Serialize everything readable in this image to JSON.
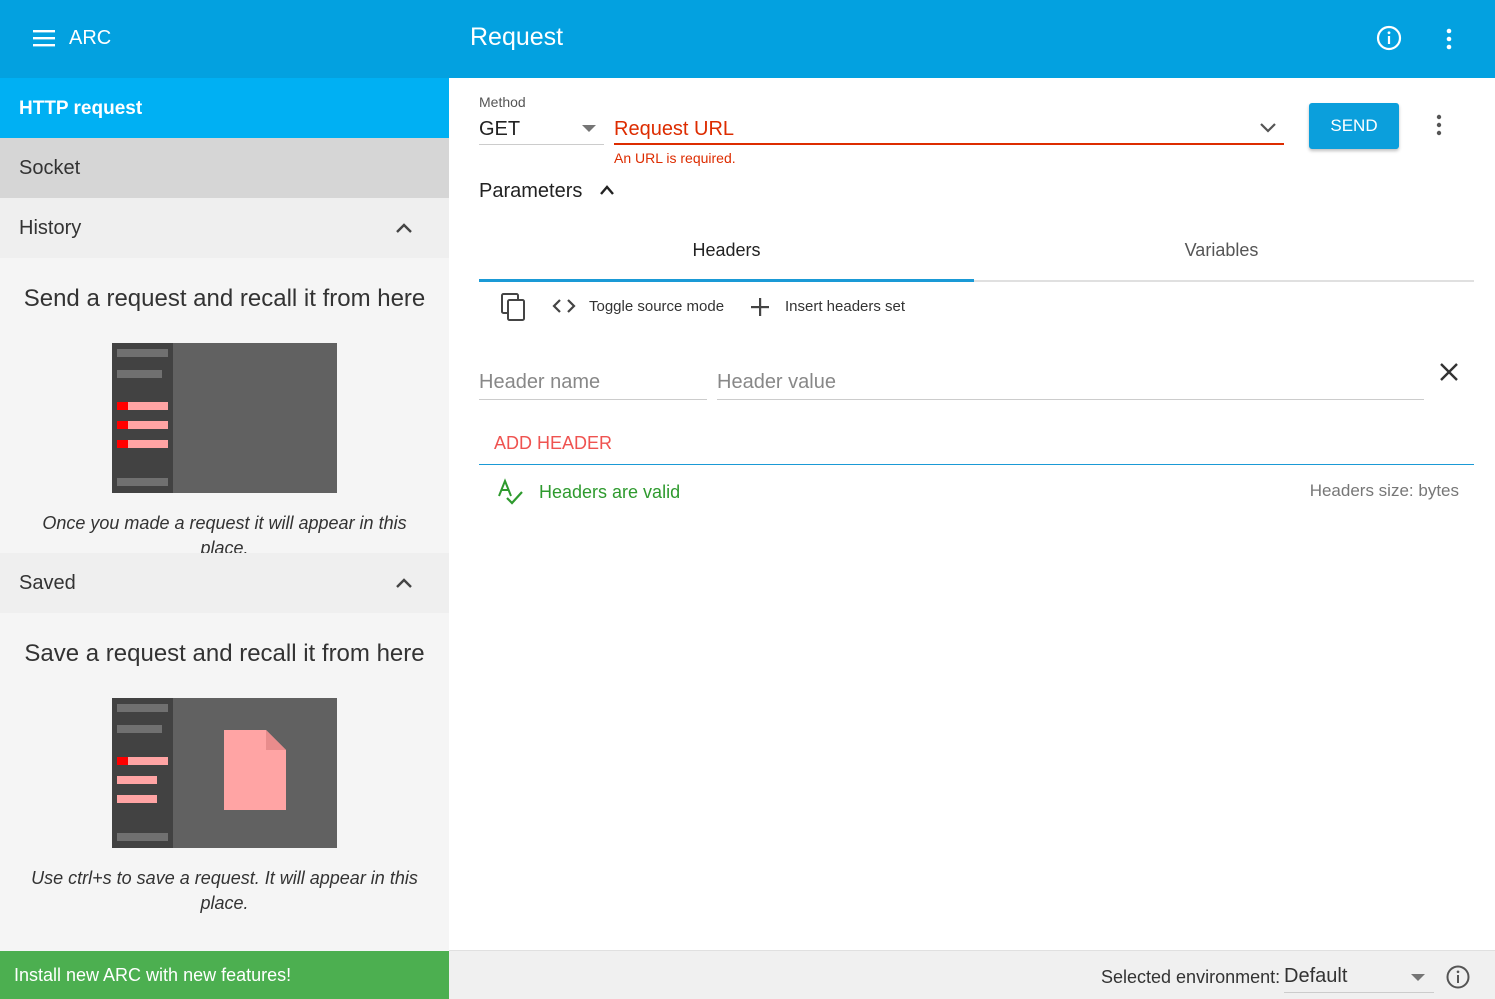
{
  "topbar": {
    "app_title": "ARC",
    "page_title": "Request",
    "background": "#03a1e0"
  },
  "sidebar": {
    "items": [
      {
        "label": "HTTP request",
        "selected": true
      },
      {
        "label": "Socket"
      }
    ],
    "history": {
      "label": "History",
      "empty_title": "Send a request and recall it from here",
      "empty_note": "Once you made a request it will appear in this place."
    },
    "saved": {
      "label": "Saved",
      "empty_title": "Save a request and recall it from here",
      "empty_note": "Use ctrl+s to save a request. It will appear in this place."
    },
    "install_banner": "Install new ARC with new features!"
  },
  "request": {
    "method_label": "Method",
    "method_value": "GET",
    "url_placeholder": "Request URL",
    "url_error": "An URL is required.",
    "send_label": "SEND",
    "parameters_label": "Parameters"
  },
  "tabs": [
    {
      "label": "Headers",
      "active": true
    },
    {
      "label": "Variables"
    }
  ],
  "headers_editor": {
    "toggle_source_label": "Toggle source mode",
    "insert_set_label": "Insert headers set",
    "name_placeholder": "Header name",
    "value_placeholder": "Header value",
    "add_header_label": "ADD HEADER",
    "valid_text": "Headers are valid",
    "size_text": "Headers size: bytes"
  },
  "footer": {
    "env_label": "Selected environment:",
    "env_value": "Default"
  },
  "colors": {
    "accent": "#03a1e0",
    "selected_item": "#00b0f3",
    "error": "#dd2c00",
    "valid": "#2e9a2e",
    "install": "#4caf50",
    "add_header": "#ef5350"
  }
}
